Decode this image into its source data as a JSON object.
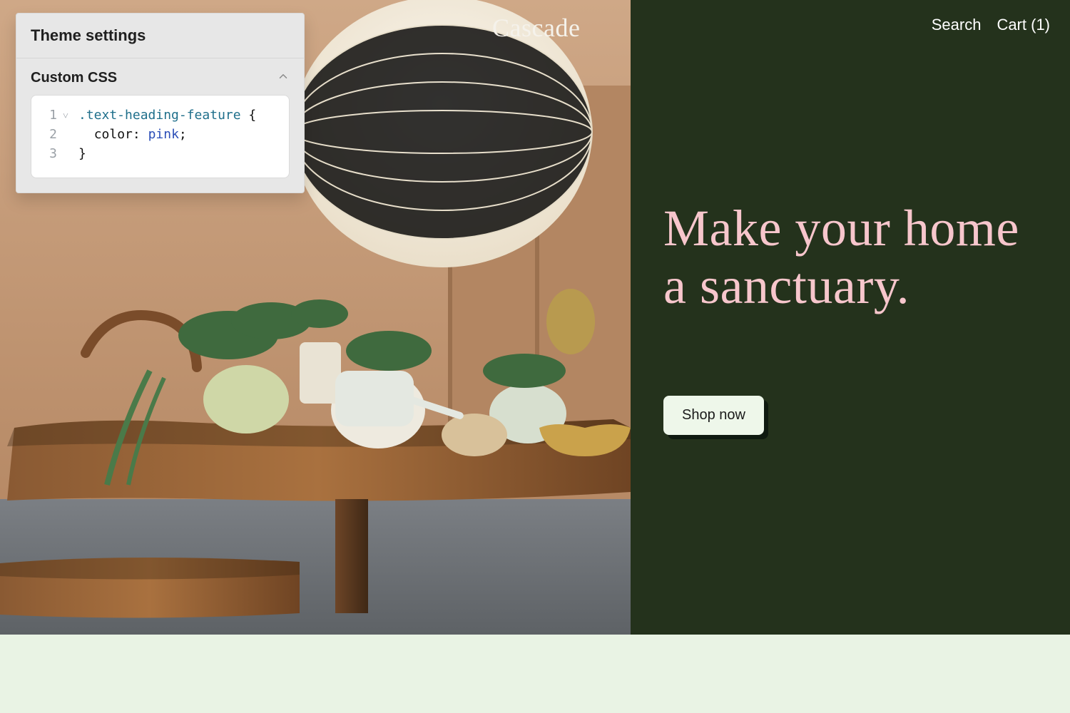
{
  "brand": "Cascade",
  "nav": {
    "search": "Search",
    "cart_label": "Cart (1)",
    "cart_count": 1
  },
  "hero": {
    "heading": "Make your home a sanctuary.",
    "cta": "Shop now"
  },
  "panel": {
    "title": "Theme settings",
    "section_title": "Custom CSS",
    "code": {
      "lines": [
        {
          "n": "1",
          "fold": "˅",
          "text_html": "<span class='tok-selector'>.text-heading-feature</span> {"
        },
        {
          "n": "2",
          "fold": "",
          "text_html": "&nbsp;&nbsp;<span class='tok-prop'>color</span>: <span class='tok-val'>pink</span>;"
        },
        {
          "n": "3",
          "fold": "",
          "text_html": "}"
        }
      ],
      "raw": ".text-heading-feature {\n  color: pink;\n}"
    }
  },
  "colors": {
    "panel_bg": "#24321c",
    "heading_pink": "#f7c6cc",
    "cta_bg": "#eef7ea",
    "strip": "#e9f3e4"
  }
}
